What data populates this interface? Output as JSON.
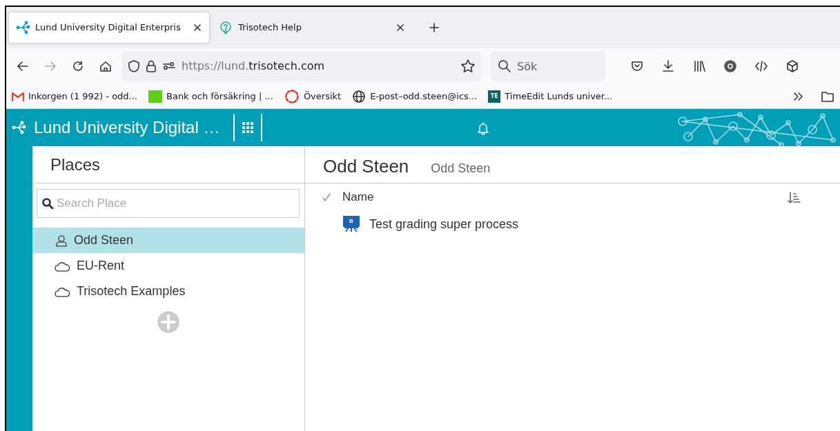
{
  "browser": {
    "tabs": [
      {
        "title": "Lund University Digital Enterpris",
        "kind": "app",
        "selected": true
      },
      {
        "title": "Trisotech Help",
        "kind": "help",
        "selected": false
      }
    ],
    "url": {
      "prefix": "https://lund.",
      "domain": "trisotech.com"
    },
    "search": {
      "placeholder": "Sök"
    },
    "bookmarks": [
      {
        "label": "Inkorgen (1 992) - odd...",
        "kind": "mail"
      },
      {
        "label": "Bank och försäkring | ...",
        "kind": "bank"
      },
      {
        "label": "Översikt",
        "kind": "ring"
      },
      {
        "label": "E-post–odd.steen@ics...",
        "kind": "globe"
      },
      {
        "label": "TimeEdit Lunds univer...",
        "kind": "badge",
        "badge": "TE"
      }
    ]
  },
  "app": {
    "title": "Lund University Digital …"
  },
  "places": {
    "title": "Places",
    "search": {
      "placeholder": "Search Place"
    },
    "items": [
      {
        "label": "Odd Steen",
        "kind": "user",
        "selected": true
      },
      {
        "label": "EU-Rent",
        "kind": "cloud",
        "selected": false
      },
      {
        "label": "Trisotech Examples",
        "kind": "cloud",
        "selected": false
      }
    ]
  },
  "content": {
    "title": "Odd Steen",
    "subtitle": "Odd Steen",
    "column": "Name",
    "rows": [
      {
        "name": "Test grading super process",
        "badge": "B"
      }
    ]
  }
}
